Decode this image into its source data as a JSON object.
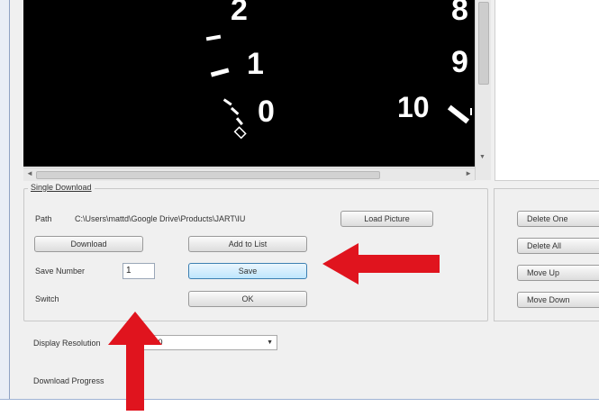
{
  "gauge": {
    "tick_numbers": [
      "2",
      "1",
      "0",
      "8",
      "9",
      "10"
    ]
  },
  "single_download": {
    "title": "Single Download",
    "path_label": "Path",
    "path_value": "C:\\Users\\mattd\\Google Drive\\Products\\JART\\IU",
    "load_picture": "Load Picture",
    "download": "Download",
    "add_to_list": "Add to List",
    "save_number_label": "Save Number",
    "save_number_value": "1",
    "save": "Save",
    "switch_label": "Switch",
    "ok": "OK"
  },
  "list_buttons": [
    "Delete One",
    "Delete All",
    "Move Up",
    "Move Down"
  ],
  "display_resolution": {
    "label": "Display Resolution",
    "value": "800x600"
  },
  "download_progress_label": "Download Progress",
  "colors": {
    "annotation_arrow": "#e0141e",
    "gauge_background": "#000000",
    "active_button": "#bee6fd"
  }
}
